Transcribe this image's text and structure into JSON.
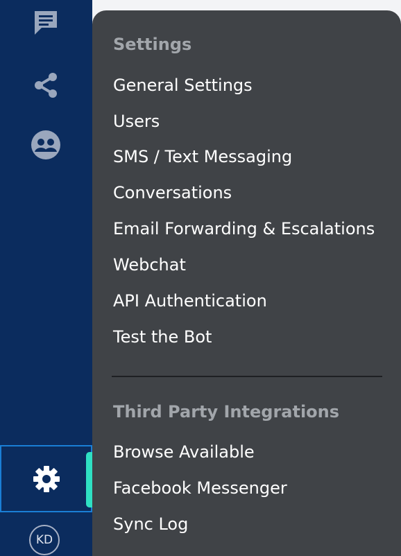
{
  "sidebar": {
    "icons": [
      "chat-icon",
      "share-icon",
      "users-group-icon"
    ],
    "settings_icon": "gear-icon",
    "avatar_initials": "KD"
  },
  "menu": {
    "settings_heading": "Settings",
    "settings_items": [
      "General Settings",
      "Users",
      "SMS / Text Messaging",
      "Conversations",
      "Email Forwarding & Escalations",
      "Webchat",
      "API Authentication",
      "Test the Bot"
    ],
    "integrations_heading": "Third Party Integrations",
    "integrations_items": [
      "Browse Available",
      "Facebook Messenger",
      "Sync Log"
    ]
  },
  "colors": {
    "sidebar_bg": "#0b2c5e",
    "flyout_bg": "#404347",
    "active_accent": "#2fe0c3",
    "heading_text": "#a2a6ab",
    "item_text": "#ffffff"
  }
}
